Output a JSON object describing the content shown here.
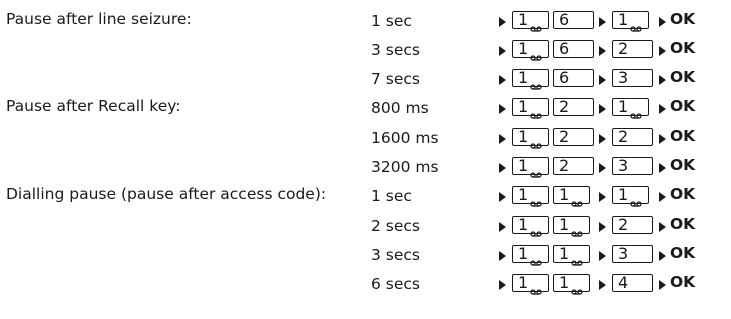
{
  "rows": [
    {
      "label": "Pause after line seizure:",
      "value": "1 sec",
      "k1": "1",
      "k2": "6",
      "k3": "1",
      "ok": "OK"
    },
    {
      "label": "",
      "value": "3 secs",
      "k1": "1",
      "k2": "6",
      "k3": "2",
      "ok": "OK"
    },
    {
      "label": "",
      "value": "7 secs",
      "k1": "1",
      "k2": "6",
      "k3": "3",
      "ok": "OK"
    },
    {
      "label": "Pause after Recall key:",
      "value": "800 ms",
      "k1": "1",
      "k2": "2",
      "k3": "1",
      "ok": "OK"
    },
    {
      "label": "",
      "value": "1600 ms",
      "k1": "1",
      "k2": "2",
      "k3": "2",
      "ok": "OK"
    },
    {
      "label": "",
      "value": "3200 ms",
      "k1": "1",
      "k2": "2",
      "k3": "3",
      "ok": "OK"
    },
    {
      "label": "Dialling pause (pause after access code):",
      "value": "1 sec",
      "k1": "1",
      "k2": "1",
      "k3": "1",
      "ok": "OK"
    },
    {
      "label": "",
      "value": "2 secs",
      "k1": "1",
      "k2": "1",
      "k3": "2",
      "ok": "OK"
    },
    {
      "label": "",
      "value": "3 secs",
      "k1": "1",
      "k2": "1",
      "k3": "3",
      "ok": "OK"
    },
    {
      "label": "",
      "value": "6 secs",
      "k1": "1",
      "k2": "1",
      "k3": "4",
      "ok": "OK"
    }
  ],
  "icons": {
    "arrow": "triangle-right-icon",
    "voicemail": "voicemail-icon"
  }
}
